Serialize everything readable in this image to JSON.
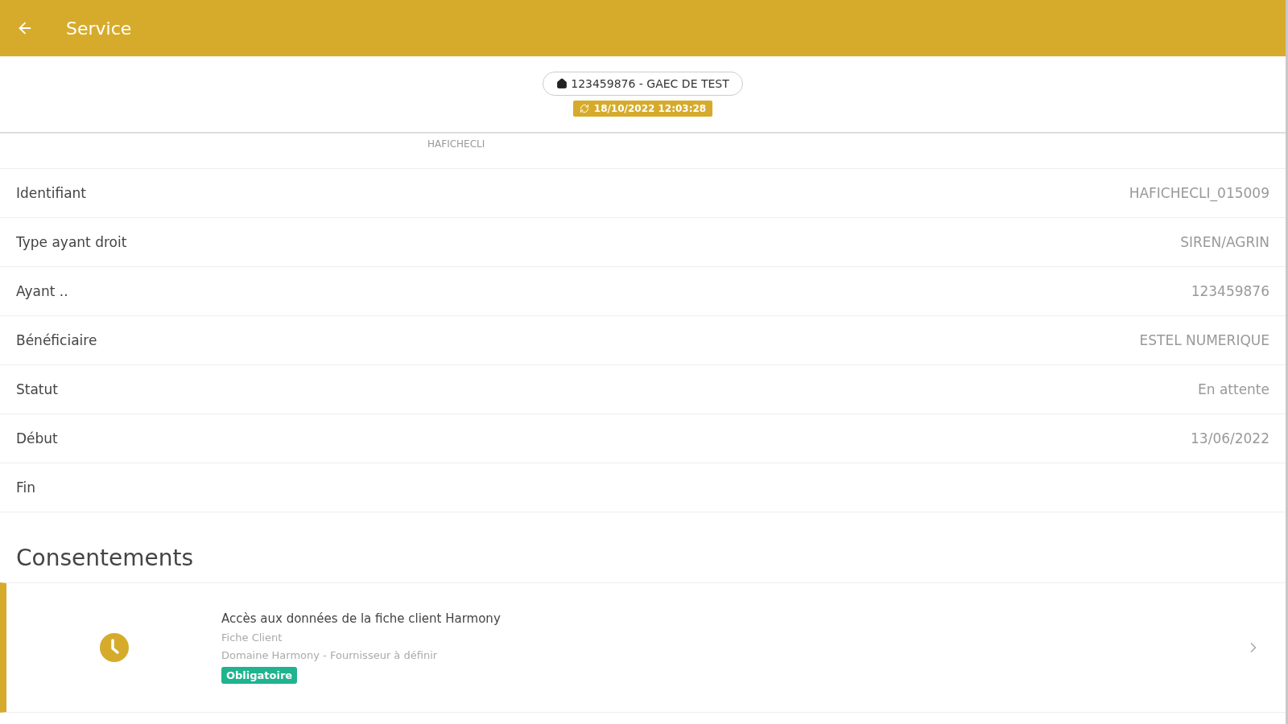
{
  "app_bar": {
    "title": "Service"
  },
  "context": {
    "account": "123459876 - GAEC DE TEST",
    "sync_time": "18/10/2022 12:03:28"
  },
  "partial_row": {
    "text": "HAFICHECLI"
  },
  "fields": [
    {
      "label": "Identifiant",
      "value": "HAFICHECLI_015009"
    },
    {
      "label": "Type ayant droit",
      "value": "SIREN/AGRIN"
    },
    {
      "label": "Ayant ..",
      "value": "123459876"
    },
    {
      "label": "Bénéficiaire",
      "value": "ESTEL NUMERIQUE"
    },
    {
      "label": "Statut",
      "value": "En attente"
    },
    {
      "label": "Début",
      "value": "13/06/2022"
    },
    {
      "label": "Fin"
    }
  ],
  "consents_title": "Consentements",
  "consents": [
    {
      "kind": "pending",
      "title": "Accès aux données de la fiche client Harmony",
      "subtitle": "Fiche Client",
      "detail": "Domaine Harmony - Fournisseur à définir",
      "tag": "Obligatoire"
    }
  ]
}
